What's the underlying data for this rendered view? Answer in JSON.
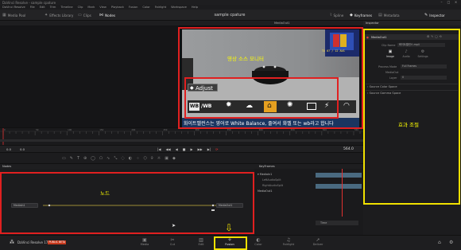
{
  "window": {
    "title": "DaVinci Resolve - sample cpature",
    "controls": [
      "–",
      "□",
      "×"
    ]
  },
  "menu": [
    "DaVinci Resolve",
    "File",
    "Edit",
    "Trim",
    "Timeline",
    "Clip",
    "Mark",
    "View",
    "Playback",
    "Fusion",
    "Color",
    "Fairlight",
    "Workspace",
    "Help"
  ],
  "toolbar": {
    "left": [
      {
        "icon": "▦",
        "label": "Media Pool"
      },
      {
        "icon": "✦",
        "label": "Effects Library"
      },
      {
        "icon": "▭",
        "label": "Clips"
      },
      {
        "icon": "⋈",
        "label": "Nodes"
      }
    ],
    "project_title": "sample cpature",
    "right": [
      {
        "icon": "⌇",
        "label": "Spline"
      },
      {
        "icon": "◆",
        "label": "Keyframes"
      },
      {
        "icon": "▤",
        "label": "Metadata"
      },
      {
        "icon": "✎",
        "label": "Inspector"
      }
    ]
  },
  "viewer": {
    "clip_name": "MediaOut1",
    "tv_text": "TX 07 / 12 AUG",
    "adjust_label": "Adjust",
    "wb_labels": [
      "WB",
      "/WB"
    ],
    "subtitle": "화이트밸런스는 영어로 White Balance, 줄여서 화벨 또는 wb라고 합니다"
  },
  "inspector": {
    "title": "Inspector",
    "node_name": "MediaOut1",
    "clip_name_label": "Clip Name",
    "clip_name_value": "화이트밸런스.mp4",
    "tabs": [
      "Image",
      "Audio",
      "Settings"
    ],
    "process_mode_label": "Process Mode",
    "process_mode_value": "Full Frames",
    "media_label": "MediaOut",
    "layer_label": "Layer",
    "layer_value": "0",
    "sections": [
      "Source Color Space",
      "Source Gamma Space"
    ]
  },
  "timeline": {
    "ticks": [
      "0",
      "10",
      "20",
      "30",
      "40",
      "50",
      "60",
      "70",
      "80",
      "90",
      "100",
      "110",
      "120",
      "130",
      "140",
      "150",
      "160",
      "170",
      "180",
      "190",
      "200",
      "210",
      "220",
      "230",
      "240",
      "250",
      "260",
      "270",
      "280",
      "290",
      "300",
      "310",
      "320",
      "330",
      "340",
      "350",
      "360",
      "370",
      "380",
      "390",
      "400",
      "410",
      "420",
      "430",
      "440",
      "450",
      "460",
      "470",
      "480",
      "490",
      "500",
      "510",
      "520",
      "530",
      "540",
      "550",
      "560"
    ],
    "start": "0.0",
    "render_start": "0.0",
    "render_end": "564.0",
    "current": "564.0",
    "transport": [
      "|◀",
      "◀◀",
      "◀",
      "■",
      "▶",
      "▶▶",
      "▶|",
      "⟳"
    ]
  },
  "nodes": {
    "title": "Nodes",
    "items": [
      {
        "name": "MediaIn1"
      },
      {
        "name": "MediaOut1"
      }
    ]
  },
  "keyframes": {
    "title": "KeyFrames",
    "tree": [
      "MediaIn1",
      "LeftAudioSplit",
      "RightAudioSplit",
      "MediaOut1"
    ],
    "footer_label": "Time"
  },
  "pagebar": {
    "app_name": "DaVinci Resolve 17",
    "badge": "PUBLIC BETA",
    "pages": [
      {
        "icon": "▣",
        "label": "Media"
      },
      {
        "icon": "✂",
        "label": "Cut"
      },
      {
        "icon": "▥",
        "label": "Edit"
      },
      {
        "icon": "✧",
        "label": "Fusion"
      },
      {
        "icon": "◐",
        "label": "Color"
      },
      {
        "icon": "♫",
        "label": "Fairlight"
      },
      {
        "icon": "➚",
        "label": "Deliver"
      }
    ]
  },
  "annotations": {
    "viewer": "영상 소스 모니터",
    "inspector": "효과 조절",
    "nodes": "노드"
  },
  "colors": {
    "annotation_red": "#e02020",
    "annotation_yellow": "#f0e000",
    "playhead": "#e03030",
    "badge": "#c83a1e"
  }
}
